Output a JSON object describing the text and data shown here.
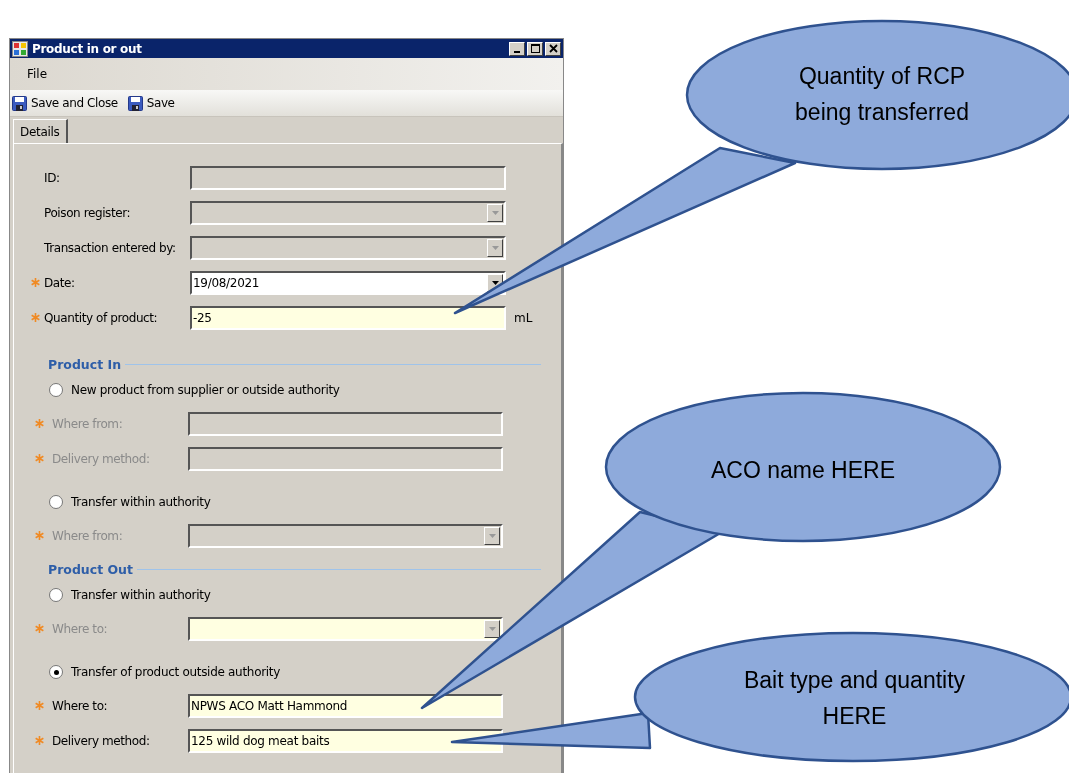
{
  "window": {
    "title": "Product in or out"
  },
  "menu": [
    "File"
  ],
  "toolbar": [
    {
      "label": "Save and Close"
    },
    {
      "label": "Save"
    }
  ],
  "tabs": [
    {
      "label": "Details",
      "selected": true
    }
  ],
  "fields": [
    {
      "label": "ID:",
      "required": false,
      "disabled": false,
      "kind": "text",
      "editable": false,
      "highlighted": false
    },
    {
      "label": "Poison register:",
      "required": false,
      "disabled": false,
      "kind": "dropdown",
      "editable": false,
      "highlighted": false
    },
    {
      "label": "Transaction entered by:",
      "required": false,
      "disabled": false,
      "kind": "dropdown",
      "editable": false,
      "highlighted": false
    },
    {
      "label": "Date:",
      "required": true,
      "disabled": false,
      "kind": "dropdown",
      "editable": true,
      "highlighted": false,
      "value": "19/08/2021"
    },
    {
      "label": "Quantity of product:",
      "required": true,
      "disabled": false,
      "kind": "text",
      "editable": true,
      "highlighted": true,
      "value": "-25",
      "unit": "mL"
    }
  ],
  "sections": [
    {
      "title": "Product In",
      "options": [
        {
          "label": "New product from supplier or outside authority",
          "selected": false,
          "fields": [
            {
              "label": "Where from:",
              "required": true,
              "disabled": true,
              "kind": "text",
              "editable": false,
              "highlighted": false
            },
            {
              "label": "Delivery method:",
              "required": true,
              "disabled": true,
              "kind": "text",
              "editable": false,
              "highlighted": false
            }
          ]
        },
        {
          "label": "Transfer within authority",
          "selected": false,
          "fields": [
            {
              "label": "Where from:",
              "required": true,
              "disabled": true,
              "kind": "dropdown",
              "editable": false,
              "highlighted": false
            }
          ]
        }
      ]
    },
    {
      "title": "Product Out",
      "options": [
        {
          "label": "Transfer within authority",
          "selected": false,
          "fields": [
            {
              "label": "Where to:",
              "required": true,
              "disabled": true,
              "kind": "dropdown",
              "editable": true,
              "highlighted": true
            }
          ]
        },
        {
          "label": "Transfer of product outside authority",
          "selected": true,
          "fields": [
            {
              "label": "Where to:",
              "required": true,
              "disabled": false,
              "kind": "text",
              "editable": true,
              "highlighted": true,
              "value": "NPWS ACO Matt Hammond"
            },
            {
              "label": "Delivery method:",
              "required": true,
              "disabled": false,
              "kind": "text",
              "editable": true,
              "highlighted": true,
              "value": "125 wild dog meat baits"
            }
          ]
        }
      ]
    }
  ],
  "callouts": [
    {
      "text": "Quantity of RCP being transferred"
    },
    {
      "text": "ACO name HERE"
    },
    {
      "text": "Bait type and quantity HERE"
    }
  ]
}
